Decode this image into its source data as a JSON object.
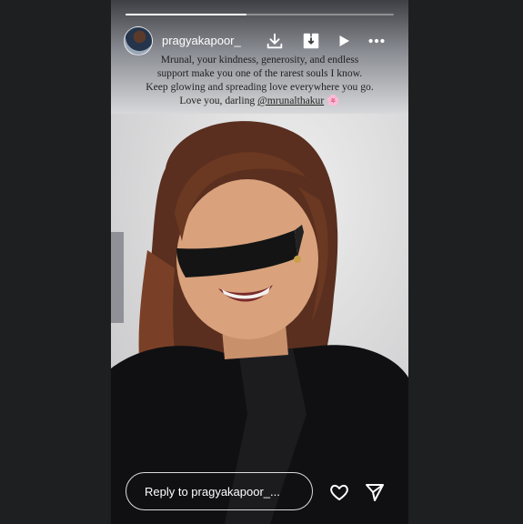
{
  "story": {
    "username": "pragyakapoor_",
    "progress": 0.45,
    "caption_line1": "Mrunal, your kindness, generosity, and endless",
    "caption_line2": "support make you one of the rarest souls I know.",
    "caption_line3": "Keep glowing and spreading love everywhere you go.",
    "caption_line4_prefix": "Love you, darling ",
    "caption_mention": "@mrunalthakur",
    "caption_emoji": "🌸",
    "reply_placeholder": "Reply to pragyakapoor_..."
  },
  "icons": {
    "download": "download-icon",
    "save": "save-icon",
    "play": "play-icon",
    "more": "more-icon",
    "like": "heart-icon",
    "share": "send-icon"
  }
}
